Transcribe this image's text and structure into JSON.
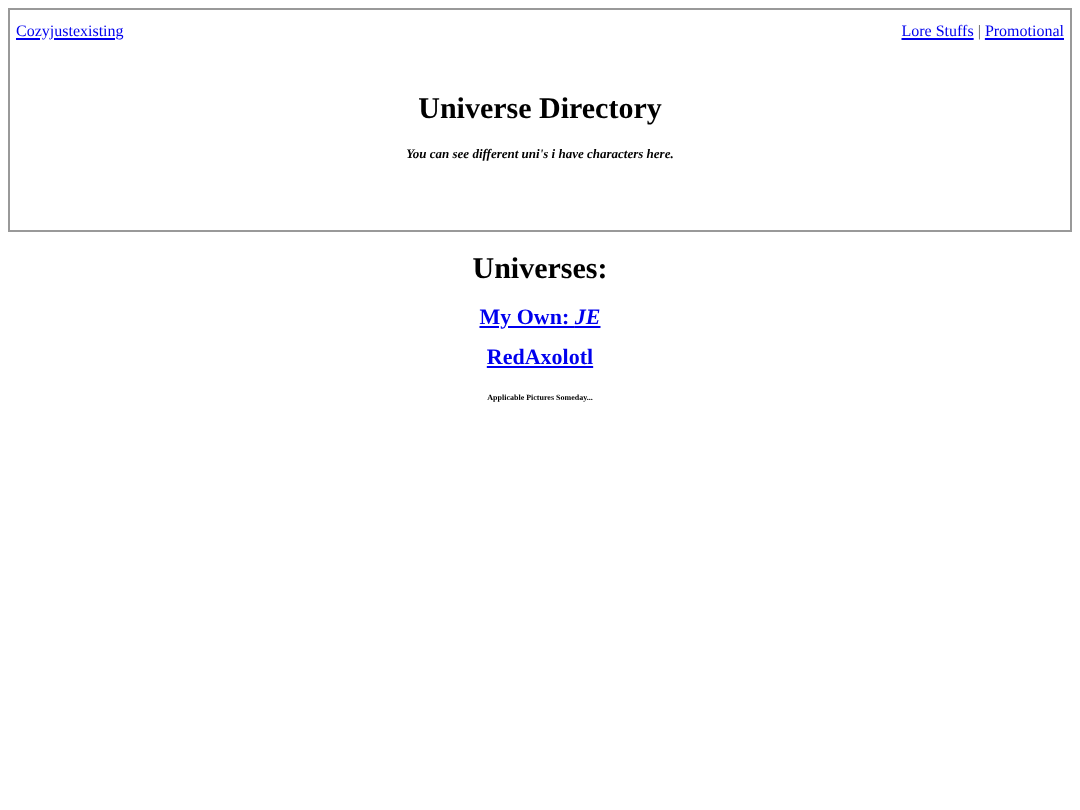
{
  "header": {
    "home_link": "Cozyjustexisting",
    "nav_links": [
      "Lore Stuffs",
      "Promotional"
    ],
    "nav_separator": "|",
    "title": "Universe Directory",
    "subtitle": "You can see different uni's i have characters here."
  },
  "universes": {
    "heading": "Universes:",
    "links": [
      "My Own: *JE*",
      "RedAxolotl"
    ],
    "note": "Applicable Pictures Someday..."
  }
}
